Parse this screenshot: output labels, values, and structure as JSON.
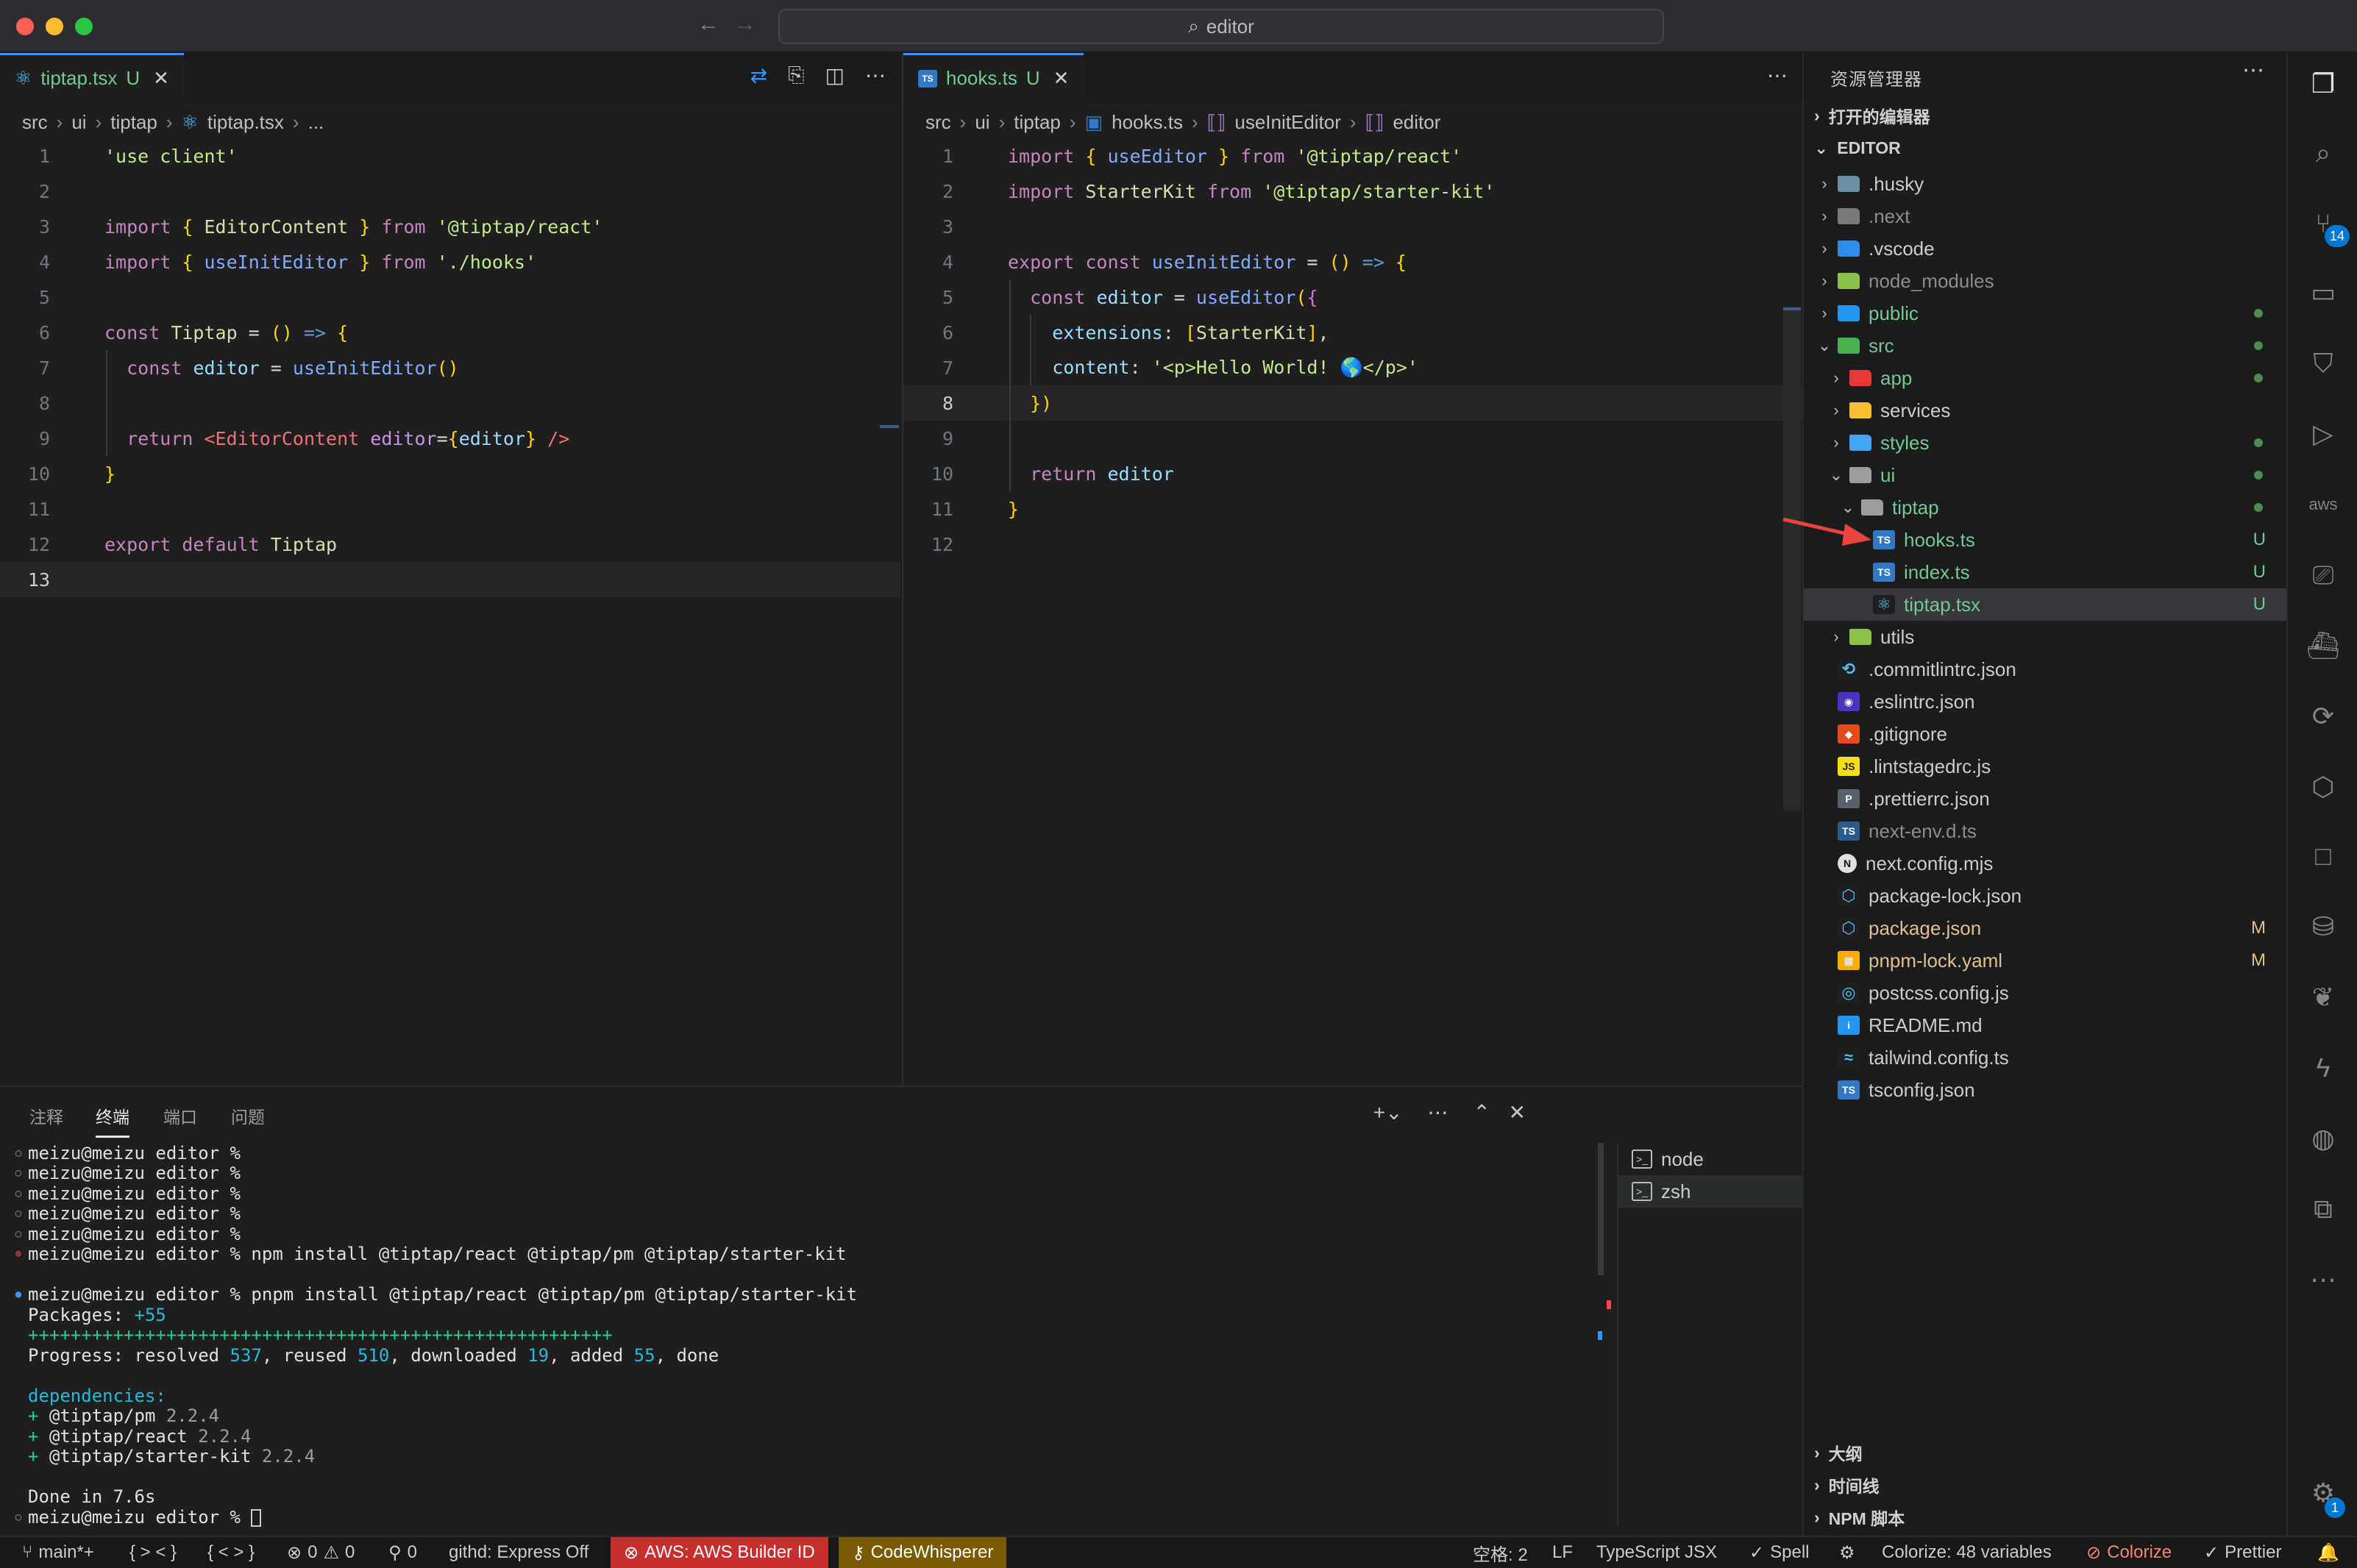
{
  "window": {
    "command_center": "editor"
  },
  "left_editor": {
    "tab": {
      "label": "tiptap.tsx",
      "status": "U"
    },
    "breadcrumb": [
      "src",
      "ui",
      "tiptap",
      "tiptap.tsx",
      "..."
    ],
    "line_numbers": [
      "1",
      "2",
      "3",
      "4",
      "5",
      "6",
      "7",
      "8",
      "9",
      "10",
      "11",
      "12",
      "13"
    ],
    "lines": [
      "'use client'",
      "",
      "import { EditorContent } from '@tiptap/react'",
      "import { useInitEditor } from './hooks'",
      "",
      "const Tiptap = () => {",
      "  const editor = useInitEditor()",
      "",
      "  return <EditorContent editor={editor} />",
      "}",
      "",
      "export default Tiptap",
      ""
    ]
  },
  "right_editor": {
    "tab": {
      "label": "hooks.ts",
      "status": "U"
    },
    "breadcrumb": [
      "src",
      "ui",
      "tiptap",
      "hooks.ts",
      "useInitEditor",
      "editor"
    ],
    "line_numbers": [
      "1",
      "2",
      "3",
      "4",
      "5",
      "6",
      "7",
      "8",
      "9",
      "10",
      "11",
      "12"
    ],
    "lines": [
      "import { useEditor } from '@tiptap/react'",
      "import StarterKit from '@tiptap/starter-kit'",
      "",
      "export const useInitEditor = () => {",
      "  const editor = useEditor({",
      "    extensions: [StarterKit],",
      "    content: '<p>Hello World! 🌎</p>'",
      "  })",
      "",
      "  return editor",
      "}",
      ""
    ]
  },
  "sidebar": {
    "title": "资源管理器",
    "open_editors": "打开的编辑器",
    "workspace": "EDITOR",
    "tree": [
      {
        "name": ".husky",
        "type": "folder",
        "depth": 1,
        "open": false,
        "color": "#6b8fa3",
        "icon": "husky-folder-icon"
      },
      {
        "name": ".next",
        "type": "folder",
        "depth": 1,
        "open": false,
        "color": "#7a7a7a",
        "icon": "next-folder-icon",
        "dim": true
      },
      {
        "name": ".vscode",
        "type": "folder",
        "depth": 1,
        "open": false,
        "color": "#2f8ce8",
        "icon": "vscode-folder-icon"
      },
      {
        "name": "node_modules",
        "type": "folder",
        "depth": 1,
        "open": false,
        "color": "#8bc34a",
        "icon": "node-modules-folder-icon",
        "dim": true
      },
      {
        "name": "public",
        "type": "folder",
        "depth": 1,
        "open": false,
        "color": "#2196f3",
        "icon": "public-folder-icon",
        "labelColor": "#73c991",
        "dot": true
      },
      {
        "name": "src",
        "type": "folder",
        "depth": 1,
        "open": true,
        "color": "#4caf50",
        "icon": "src-folder-icon",
        "labelColor": "#73c991",
        "dot": true
      },
      {
        "name": "app",
        "type": "folder",
        "depth": 2,
        "open": false,
        "color": "#e53935",
        "icon": "app-folder-icon",
        "labelColor": "#73c991",
        "dot": true
      },
      {
        "name": "services",
        "type": "folder",
        "depth": 2,
        "open": false,
        "color": "#fbc02d",
        "icon": "services-folder-icon"
      },
      {
        "name": "styles",
        "type": "folder",
        "depth": 2,
        "open": false,
        "color": "#42a5f5",
        "icon": "styles-folder-icon",
        "labelColor": "#73c991",
        "dot": true
      },
      {
        "name": "ui",
        "type": "folder",
        "depth": 2,
        "open": true,
        "color": "#9e9e9e",
        "icon": "ui-folder-icon",
        "labelColor": "#73c991",
        "dot": true
      },
      {
        "name": "tiptap",
        "type": "folder",
        "depth": 3,
        "open": true,
        "color": "#9e9e9e",
        "icon": "tiptap-folder-icon",
        "labelColor": "#73c991",
        "dot": true
      },
      {
        "name": "hooks.ts",
        "type": "file",
        "depth": 4,
        "color": "#3178c6",
        "glyph": "TS",
        "icon": "typescript-file-icon",
        "labelColor": "#73c991",
        "badge": "U"
      },
      {
        "name": "index.ts",
        "type": "file",
        "depth": 4,
        "color": "#3178c6",
        "glyph": "TS",
        "icon": "typescript-file-icon",
        "labelColor": "#73c991",
        "badge": "U"
      },
      {
        "name": "tiptap.tsx",
        "type": "file",
        "depth": 4,
        "color": "#1f1f1f",
        "glyph": "⚛",
        "icon": "react-file-icon",
        "labelColor": "#73c991",
        "badge": "U",
        "selected": true
      },
      {
        "name": "utils",
        "type": "folder",
        "depth": 2,
        "open": false,
        "color": "#8bc34a",
        "icon": "utils-folder-icon"
      },
      {
        "name": ".commitlintrc.json",
        "type": "file",
        "depth": 1,
        "color": "#1f1f1f",
        "glyph": "⟲",
        "icon": "commitlint-file-icon"
      },
      {
        "name": ".eslintrc.json",
        "type": "file",
        "depth": 1,
        "color": "#4b32c3",
        "glyph": "◉",
        "icon": "eslint-file-icon"
      },
      {
        "name": ".gitignore",
        "type": "file",
        "depth": 1,
        "color": "#e64a19",
        "glyph": "◆",
        "icon": "git-file-icon"
      },
      {
        "name": ".lintstagedrc.js",
        "type": "file",
        "depth": 1,
        "color": "#f5de19",
        "glyph": "JS",
        "icon": "javascript-file-icon"
      },
      {
        "name": ".prettierrc.json",
        "type": "file",
        "depth": 1,
        "color": "#56616b",
        "glyph": "P",
        "icon": "prettier-file-icon"
      },
      {
        "name": "next-env.d.ts",
        "type": "file",
        "depth": 1,
        "color": "#2b5b8a",
        "glyph": "TS",
        "icon": "typescript-def-file-icon",
        "dim": true
      },
      {
        "name": "next.config.mjs",
        "type": "file",
        "depth": 1,
        "color": "#e0e0e0",
        "glyph": "N",
        "icon": "nextjs-file-icon"
      },
      {
        "name": "package-lock.json",
        "type": "file",
        "depth": 1,
        "color": "#1f1f1f",
        "glyph": "⬡",
        "icon": "npm-lock-file-icon"
      },
      {
        "name": "package.json",
        "type": "file",
        "depth": 1,
        "color": "#1f1f1f",
        "glyph": "⬡",
        "icon": "nodejs-file-icon",
        "labelColor": "#e2c08d",
        "badge": "M"
      },
      {
        "name": "pnpm-lock.yaml",
        "type": "file",
        "depth": 1,
        "color": "#f9ad00",
        "glyph": "▦",
        "icon": "pnpm-file-icon",
        "labelColor": "#e2c08d",
        "badge": "M"
      },
      {
        "name": "postcss.config.js",
        "type": "file",
        "depth": 1,
        "color": "#1f1f1f",
        "glyph": "◎",
        "icon": "postcss-file-icon"
      },
      {
        "name": "README.md",
        "type": "file",
        "depth": 1,
        "color": "#2196f3",
        "glyph": "i",
        "icon": "info-file-icon"
      },
      {
        "name": "tailwind.config.ts",
        "type": "file",
        "depth": 1,
        "color": "#1f1f1f",
        "glyph": "≈",
        "icon": "tailwind-file-icon"
      },
      {
        "name": "tsconfig.json",
        "type": "file",
        "depth": 1,
        "color": "#3178c6",
        "glyph": "TS",
        "icon": "tsconfig-file-icon"
      }
    ],
    "bottom_sections": [
      "大纲",
      "时间线",
      "NPM 脚本"
    ]
  },
  "panel": {
    "tabs": [
      "注释",
      "终端",
      "端口",
      "问题"
    ],
    "active_tab": "终端",
    "terminal_lines": [
      {
        "mark": "○",
        "text": "meizu@meizu editor % "
      },
      {
        "mark": "○",
        "text": "meizu@meizu editor % "
      },
      {
        "mark": "○",
        "text": "meizu@meizu editor % "
      },
      {
        "mark": "○",
        "text": "meizu@meizu editor % "
      },
      {
        "mark": "○",
        "text": "meizu@meizu editor % "
      },
      {
        "mark": "⊗",
        "text": "meizu@meizu editor % npm install @tiptap/react @tiptap/pm @tiptap/starter-kit"
      },
      {
        "mark": "",
        "text": ""
      },
      {
        "mark": "●",
        "text": "meizu@meizu editor % pnpm install @tiptap/react @tiptap/pm @tiptap/starter-kit"
      },
      {
        "mark": "",
        "text": "Packages: +55"
      },
      {
        "mark": "",
        "text": "+++++++++++++++++++++++++++++++++++++++++++++++++++++++"
      },
      {
        "mark": "",
        "text": "Progress: resolved 537, reused 510, downloaded 19, added 55, done"
      },
      {
        "mark": "",
        "text": ""
      },
      {
        "mark": "",
        "text": "dependencies:"
      },
      {
        "mark": "",
        "text": "+ @tiptap/pm 2.2.4"
      },
      {
        "mark": "",
        "text": "+ @tiptap/react 2.2.4"
      },
      {
        "mark": "",
        "text": "+ @tiptap/starter-kit 2.2.4"
      },
      {
        "mark": "",
        "text": ""
      },
      {
        "mark": "",
        "text": "Done in 7.6s"
      },
      {
        "mark": "○",
        "text": "meizu@meizu editor % "
      }
    ],
    "terminals": [
      "node",
      "zsh"
    ]
  },
  "statusbar": {
    "branch": "main*+",
    "brackets1": "{ > < }",
    "brackets2": "{ < > }",
    "errors": "0",
    "warnings": "0",
    "ports": "0",
    "githd": "githd: Express Off",
    "aws": "AWS: AWS Builder ID",
    "codewhisperer": "CodeWhisperer",
    "indent": "空格: 2",
    "eol": "LF",
    "language": "TypeScript JSX",
    "spell": "Spell",
    "colorize_vars": "Colorize: 48 variables",
    "colorize": "Colorize",
    "prettier": "Prettier"
  },
  "activity": {
    "scm_badge": "14",
    "settings_badge": "1"
  }
}
